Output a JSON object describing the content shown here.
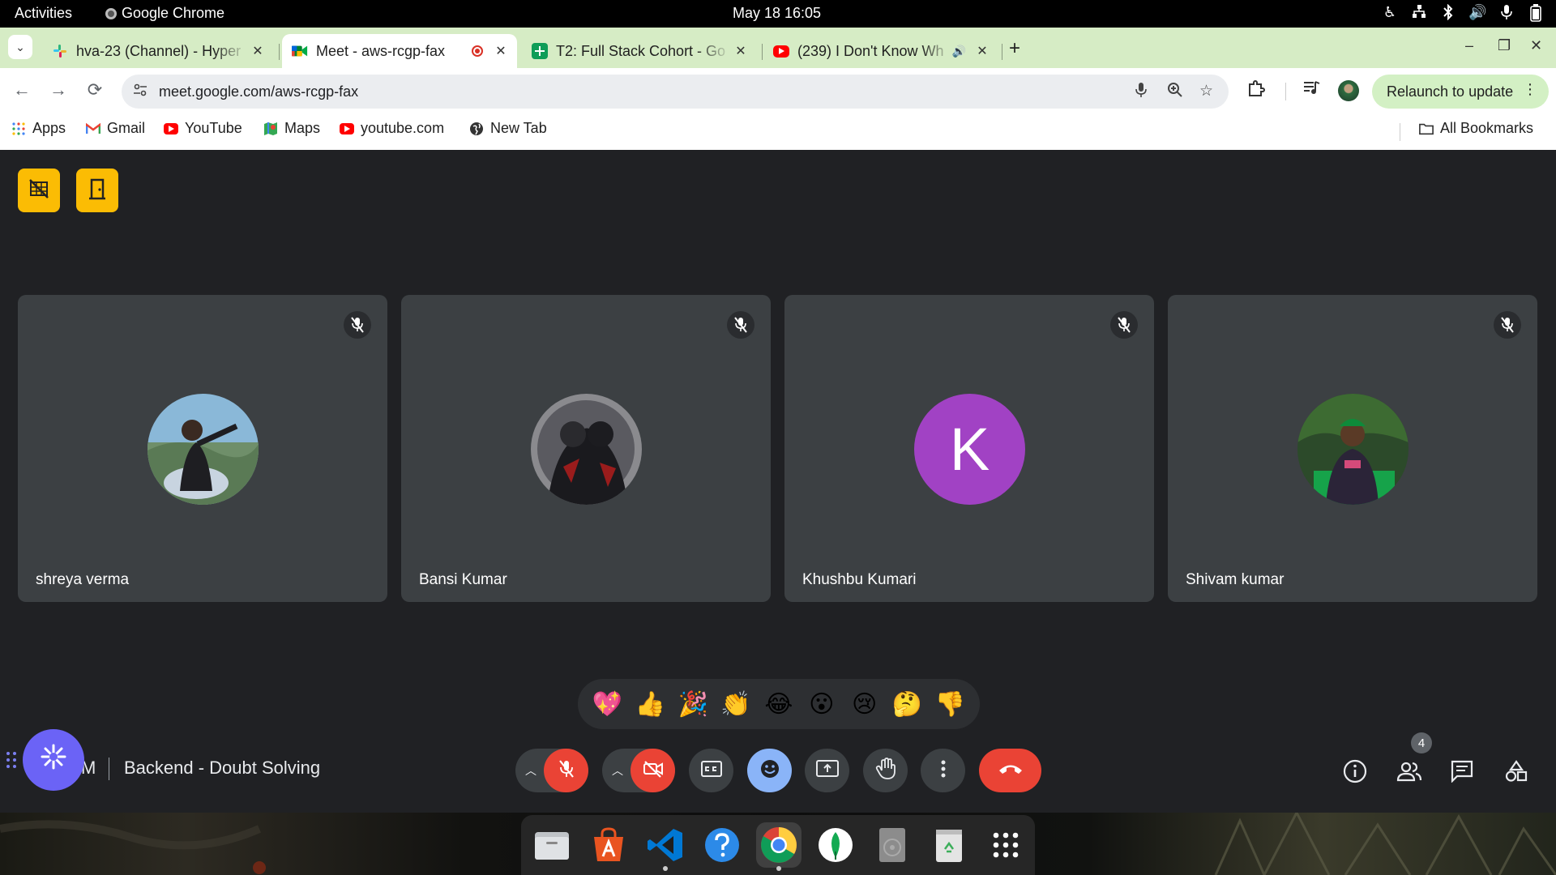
{
  "system_bar": {
    "activities": "Activities",
    "app_name": "Google Chrome",
    "datetime": "May 18  16:05"
  },
  "tabs": [
    {
      "title": "hva-23 (Channel) - Hyper",
      "favicon": "slack-icon"
    },
    {
      "title": "Meet - aws-rcgp-fax",
      "favicon": "meet-icon",
      "active": true,
      "recording": true
    },
    {
      "title": "T2: Full Stack Cohort - Go",
      "favicon": "sheets-icon"
    },
    {
      "title": "(239) I Don't Know Wh",
      "favicon": "youtube-icon",
      "audio": true
    }
  ],
  "toolbar": {
    "url": "meet.google.com/aws-rcgp-fax",
    "relaunch_label": "Relaunch to update"
  },
  "bookmarks": {
    "items": [
      {
        "label": "Apps",
        "icon": "apps-grid-icon"
      },
      {
        "label": "Gmail",
        "icon": "gmail-icon"
      },
      {
        "label": "YouTube",
        "icon": "youtube-icon"
      },
      {
        "label": "Maps",
        "icon": "maps-icon"
      },
      {
        "label": "youtube.com",
        "icon": "youtube-icon"
      },
      {
        "label": "New Tab",
        "icon": "globe-icon"
      }
    ],
    "all_bookmarks": "All Bookmarks"
  },
  "participants": [
    {
      "name": "shreya verma",
      "muted": true,
      "avatar": "photo"
    },
    {
      "name": "Bansi Kumar",
      "muted": true,
      "avatar": "photo"
    },
    {
      "name": "Khushbu Kumari",
      "muted": true,
      "avatar": "letter",
      "letter": "K",
      "avatar_color": "#a142c4"
    },
    {
      "name": "Shivam kumar",
      "muted": true,
      "avatar": "photo"
    }
  ],
  "reactions": [
    "💖",
    "👍",
    "🎉",
    "👏",
    "😂",
    "😮",
    "😢",
    "🤔",
    "👎"
  ],
  "meeting": {
    "code_partial": "M",
    "title": "Backend - Doubt Solving",
    "participant_count": "4"
  },
  "colors": {
    "meet_bg": "#202124",
    "tile_bg": "#3c4043",
    "end_call": "#ea4335",
    "reaction_active": "#8ab4f8",
    "yellow_button": "#fbbc04"
  }
}
